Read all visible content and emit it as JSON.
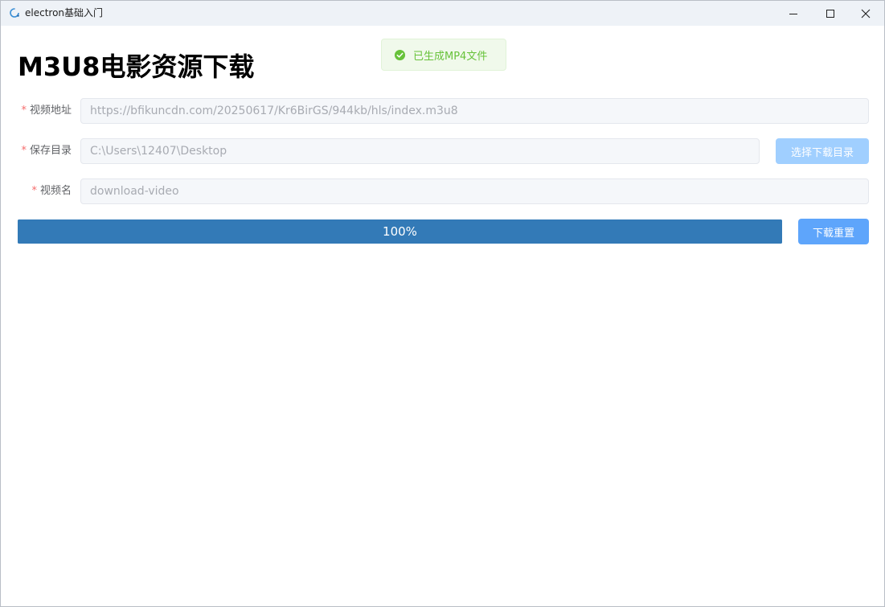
{
  "window": {
    "title": "electron基础入门",
    "controls": {
      "minimize_icon": "minimize-icon",
      "maximize_icon": "maximize-icon",
      "close_icon": "close-icon"
    }
  },
  "toast": {
    "icon": "check-circle-icon",
    "message": "已生成MP4文件",
    "color": "#67c23a"
  },
  "page": {
    "title": "M3U8电影资源下载"
  },
  "form": {
    "required_mark": "*",
    "url": {
      "label": "视频地址",
      "value": "https://bfikuncdn.com/20250617/Kr6BirGS/944kb/hls/index.m3u8"
    },
    "save_dir": {
      "label": "保存目录",
      "value": "C:\\Users\\12407\\Desktop",
      "button_label": "选择下载目录"
    },
    "video_name": {
      "label": "视频名",
      "value": "download-video"
    }
  },
  "progress": {
    "percent": 100,
    "label": "100%",
    "color": "#337ab7"
  },
  "actions": {
    "reset_label": "下载重置",
    "accent_color": "#409eff"
  }
}
